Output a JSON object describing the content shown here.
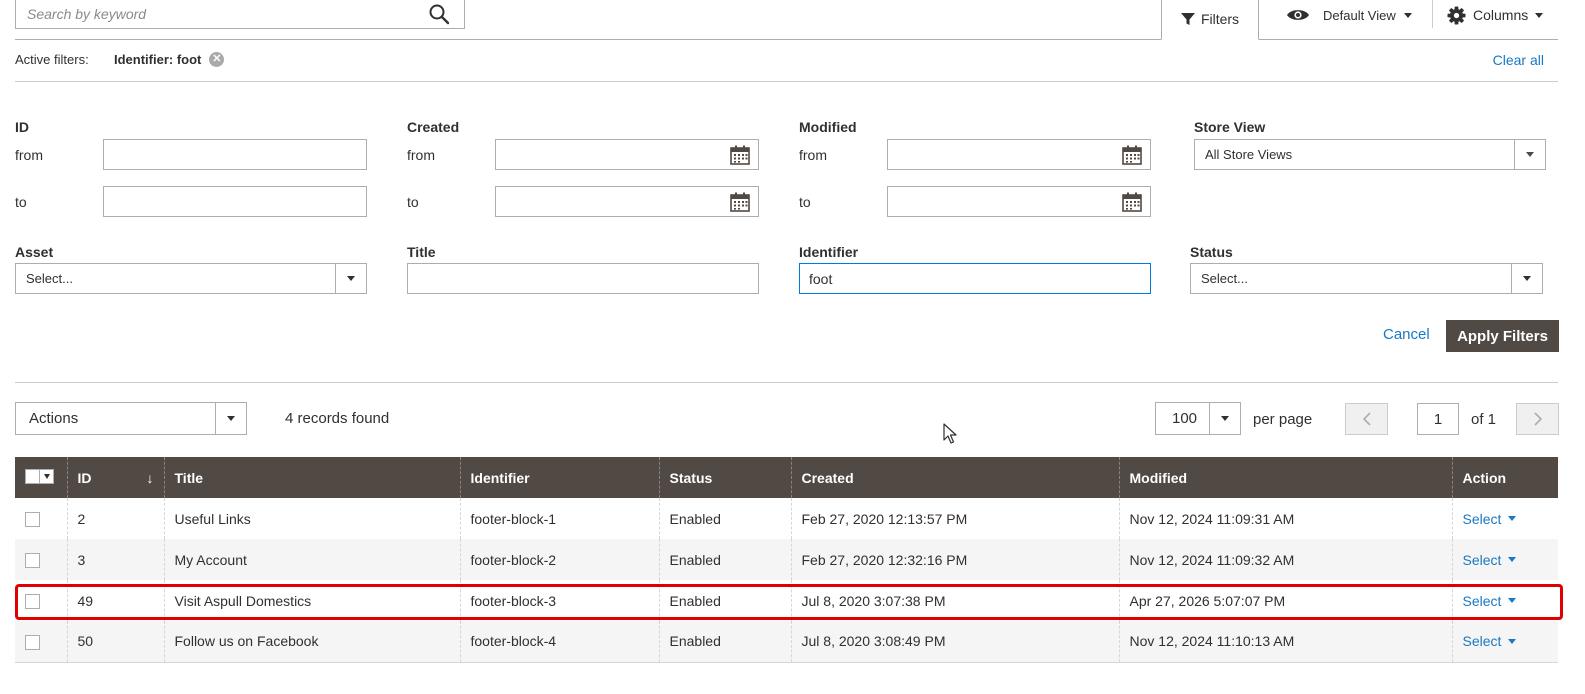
{
  "search": {
    "placeholder": "Search by keyword"
  },
  "toolbar": {
    "filters_label": "Filters",
    "default_view_label": "Default View",
    "columns_label": "Columns"
  },
  "active_filters": {
    "label": "Active filters:",
    "chip": "Identifier: foot",
    "clear_all": "Clear all"
  },
  "filters": {
    "id": {
      "label": "ID",
      "from_label": "from",
      "to_label": "to",
      "from_value": "",
      "to_value": ""
    },
    "created": {
      "label": "Created",
      "from_label": "from",
      "to_label": "to",
      "from_value": "",
      "to_value": ""
    },
    "modified": {
      "label": "Modified",
      "from_label": "from",
      "to_label": "to",
      "from_value": "",
      "to_value": ""
    },
    "store_view": {
      "label": "Store View",
      "value": "All Store Views"
    },
    "asset": {
      "label": "Asset",
      "value": "Select..."
    },
    "title": {
      "label": "Title",
      "value": ""
    },
    "identifier": {
      "label": "Identifier",
      "value": "foot"
    },
    "status": {
      "label": "Status",
      "value": "Select..."
    },
    "cancel_label": "Cancel",
    "apply_label": "Apply Filters"
  },
  "grid_controls": {
    "actions_label": "Actions",
    "records_found": "4 records found",
    "per_page_value": "100",
    "per_page_label": "per page",
    "current_page": "1",
    "of_pages": "of 1"
  },
  "grid": {
    "columns": [
      "ID",
      "Title",
      "Identifier",
      "Status",
      "Created",
      "Modified",
      "Action"
    ],
    "rows": [
      {
        "id": "2",
        "title": "Useful Links",
        "identifier": "footer-block-1",
        "status": "Enabled",
        "created": "Feb 27, 2020 12:13:57 PM",
        "modified": "Nov 12, 2024 11:09:31 AM",
        "action": "Select"
      },
      {
        "id": "3",
        "title": "My Account",
        "identifier": "footer-block-2",
        "status": "Enabled",
        "created": "Feb 27, 2020 12:32:16 PM",
        "modified": "Nov 12, 2024 11:09:32 AM",
        "action": "Select"
      },
      {
        "id": "49",
        "title": "Visit Aspull Domestics",
        "identifier": "footer-block-3",
        "status": "Enabled",
        "created": "Jul 8, 2020 3:07:38 PM",
        "modified": "Apr 27, 2026 5:07:07 PM",
        "action": "Select"
      },
      {
        "id": "50",
        "title": "Follow us on Facebook",
        "identifier": "footer-block-4",
        "status": "Enabled",
        "created": "Jul 8, 2020 3:08:49 PM",
        "modified": "Nov 12, 2024 11:10:13 AM",
        "action": "Select"
      }
    ]
  },
  "colors": {
    "header_bg": "#514943",
    "link": "#1979c3",
    "highlight": "#e00000",
    "focus": "#007bdb"
  }
}
